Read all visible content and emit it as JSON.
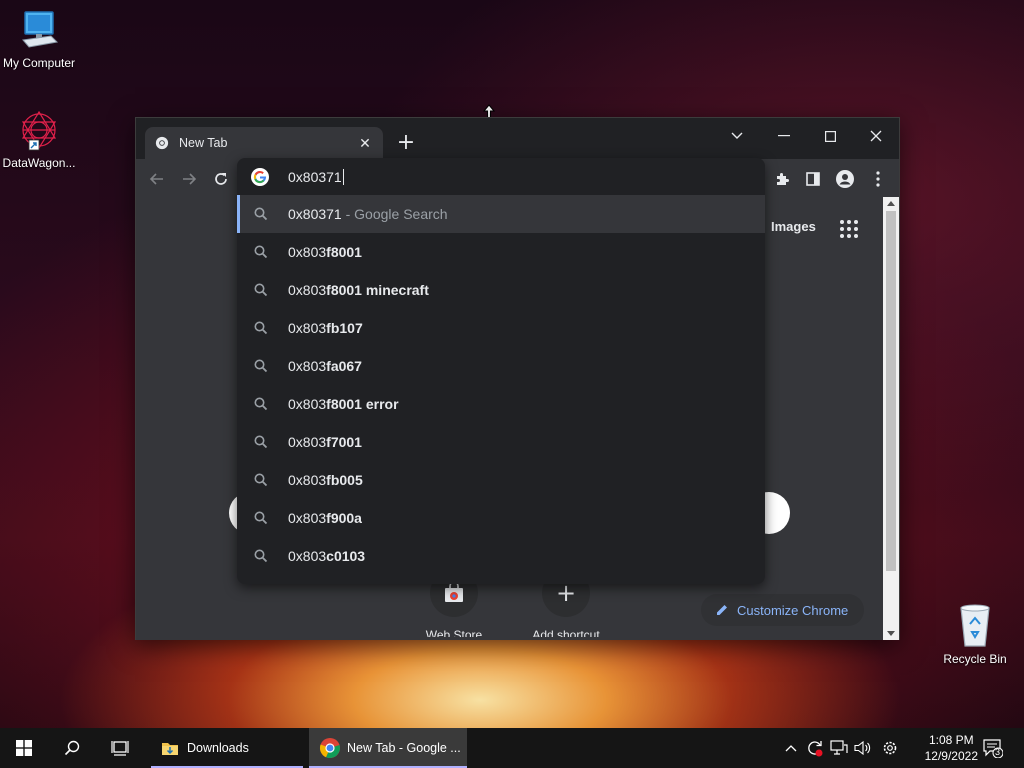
{
  "desktop": {
    "icons": [
      {
        "label": "My Computer",
        "icon": "computer-icon"
      },
      {
        "label": "DataWagon...",
        "icon": "datawagon-icon"
      },
      {
        "label": "Recycle Bin",
        "icon": "recycle-bin-icon"
      }
    ]
  },
  "browser": {
    "tab_title": "New Tab",
    "new_tab_symbol": "+",
    "omnibox": {
      "text": "0x80371",
      "suggestions": [
        {
          "prefix": "0x80371",
          "bold": "",
          "suffix": " - Google Search",
          "selected": true
        },
        {
          "prefix": "0x803",
          "bold": "f8001",
          "suffix": ""
        },
        {
          "prefix": "0x803",
          "bold": "f8001 minecraft",
          "suffix": ""
        },
        {
          "prefix": "0x803",
          "bold": "fb107",
          "suffix": ""
        },
        {
          "prefix": "0x803",
          "bold": "fa067",
          "suffix": ""
        },
        {
          "prefix": "0x803",
          "bold": "f8001 error",
          "suffix": ""
        },
        {
          "prefix": "0x803",
          "bold": "f7001",
          "suffix": ""
        },
        {
          "prefix": "0x803",
          "bold": "fb005",
          "suffix": ""
        },
        {
          "prefix": "0x803",
          "bold": "f900a",
          "suffix": ""
        },
        {
          "prefix": "0x803",
          "bold": "c0103",
          "suffix": ""
        }
      ]
    },
    "newtab_page": {
      "images_link": "Images",
      "shortcuts": [
        {
          "label": "Web Store",
          "icon": "web-store-icon"
        },
        {
          "label": "Add shortcut",
          "icon": "plus-icon"
        }
      ],
      "customize_label": "Customize Chrome"
    }
  },
  "taskbar": {
    "apps": [
      {
        "label": "Downloads",
        "icon": "folder-icon"
      },
      {
        "label": "New Tab - Google ...",
        "icon": "chrome-icon"
      }
    ],
    "clock_time": "1:08 PM",
    "clock_date": "12/9/2022",
    "notification_count": "3"
  },
  "colors": {
    "accent": "#8ab4f8",
    "chrome_dark": "#202124",
    "toolbar": "#35363a"
  }
}
